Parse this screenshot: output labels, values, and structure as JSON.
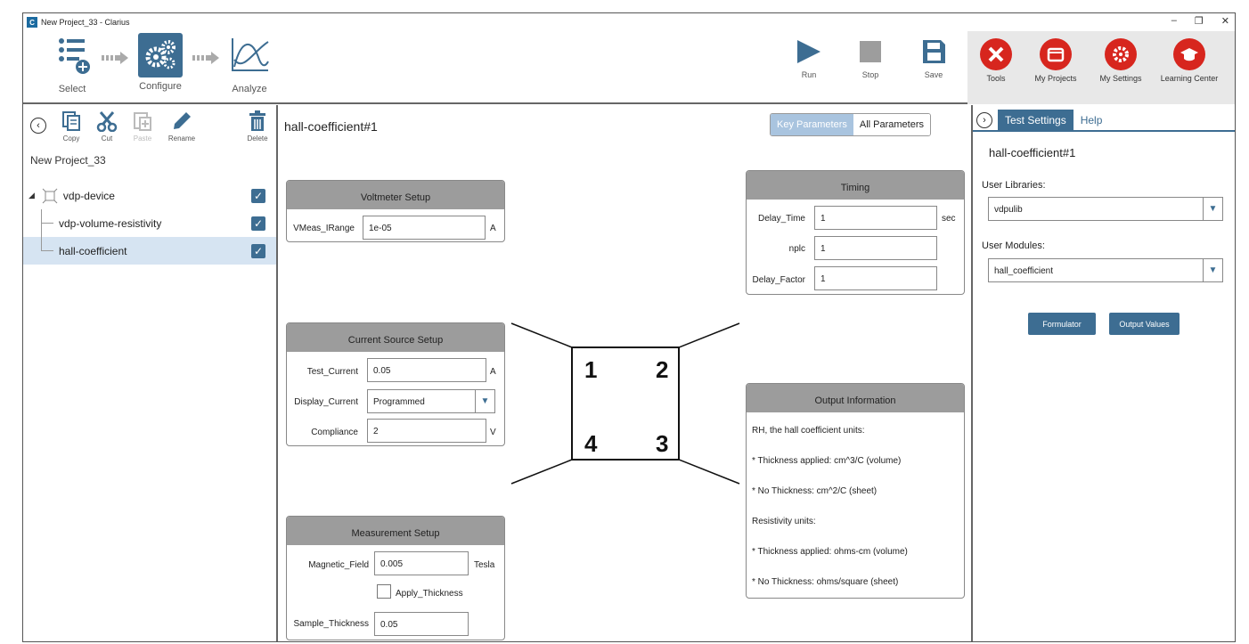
{
  "window": {
    "title": "New Project_33 - Clarius",
    "logo": "C",
    "controls": [
      "–",
      "❐",
      "✕"
    ]
  },
  "workflow": {
    "select": "Select",
    "configure": "Configure",
    "analyze": "Analyze"
  },
  "toolbar": {
    "run": "Run",
    "stop": "Stop",
    "save": "Save"
  },
  "tools": {
    "tools": "Tools",
    "projects": "My Projects",
    "settings": "My Settings",
    "learning": "Learning Center"
  },
  "project": {
    "toolbar": {
      "copy": "Copy",
      "cut": "Cut",
      "paste": "Paste",
      "rename": "Rename",
      "delete": "Delete"
    },
    "name": "New Project_33",
    "tree": [
      {
        "label": "vdp-device",
        "checked": true
      },
      {
        "label": "vdp-volume-resistivity",
        "checked": true
      },
      {
        "label": "hall-coefficient",
        "checked": true,
        "selected": true
      }
    ]
  },
  "test": {
    "title": "hall-coefficient#1",
    "view_tabs": {
      "key": "Key Parameters",
      "all": "All Parameters"
    },
    "voltmeter": {
      "header": "Voltmeter Setup",
      "label": "VMeas_IRange",
      "value": "1e-05",
      "unit": "A"
    },
    "current_source": {
      "header": "Current Source Setup",
      "test_current": {
        "label": "Test_Current",
        "value": "0.05",
        "unit": "A"
      },
      "display_current": {
        "label": "Display_Current",
        "value": "Programmed"
      },
      "compliance": {
        "label": "Compliance",
        "value": "2",
        "unit": "V"
      }
    },
    "measurement": {
      "header": "Measurement Setup",
      "magnetic_field": {
        "label": "Magnetic_Field",
        "value": "0.005",
        "unit": "Tesla"
      },
      "apply_thickness": {
        "label": "Apply_Thickness",
        "checked": false
      },
      "sample_thickness": {
        "label": "Sample_Thickness",
        "value": "0.05"
      }
    },
    "timing": {
      "header": "Timing",
      "delay_time": {
        "label": "Delay_Time",
        "value": "1",
        "unit": "sec"
      },
      "nplc": {
        "label": "nplc",
        "value": "1"
      },
      "delay_factor": {
        "label": "Delay_Factor",
        "value": "1"
      }
    },
    "output": {
      "header": "Output Information",
      "lines": [
        "RH, the hall coefficient units:",
        "* Thickness applied: cm^3/C (volume)",
        "* No Thickness: cm^2/C (sheet)",
        "Resistivity units:",
        "* Thickness applied: ohms-cm (volume)",
        "* No Thickness: ohms/square (sheet)"
      ]
    },
    "diagram": {
      "pins": [
        "1",
        "2",
        "4",
        "3"
      ]
    }
  },
  "right_panel": {
    "tabs": {
      "settings": "Test Settings",
      "help": "Help"
    },
    "title": "hall-coefficient#1",
    "libraries_label": "User Libraries:",
    "library": "vdpulib",
    "modules_label": "User Modules:",
    "module": "hall_coefficient",
    "formulator": "Formulator",
    "output_values": "Output Values"
  },
  "colors": {
    "accent": "#3d6d92",
    "highlight": "#d6e4f2",
    "brand_red": "#d7261e",
    "panel_header": "#9c9c9c"
  }
}
